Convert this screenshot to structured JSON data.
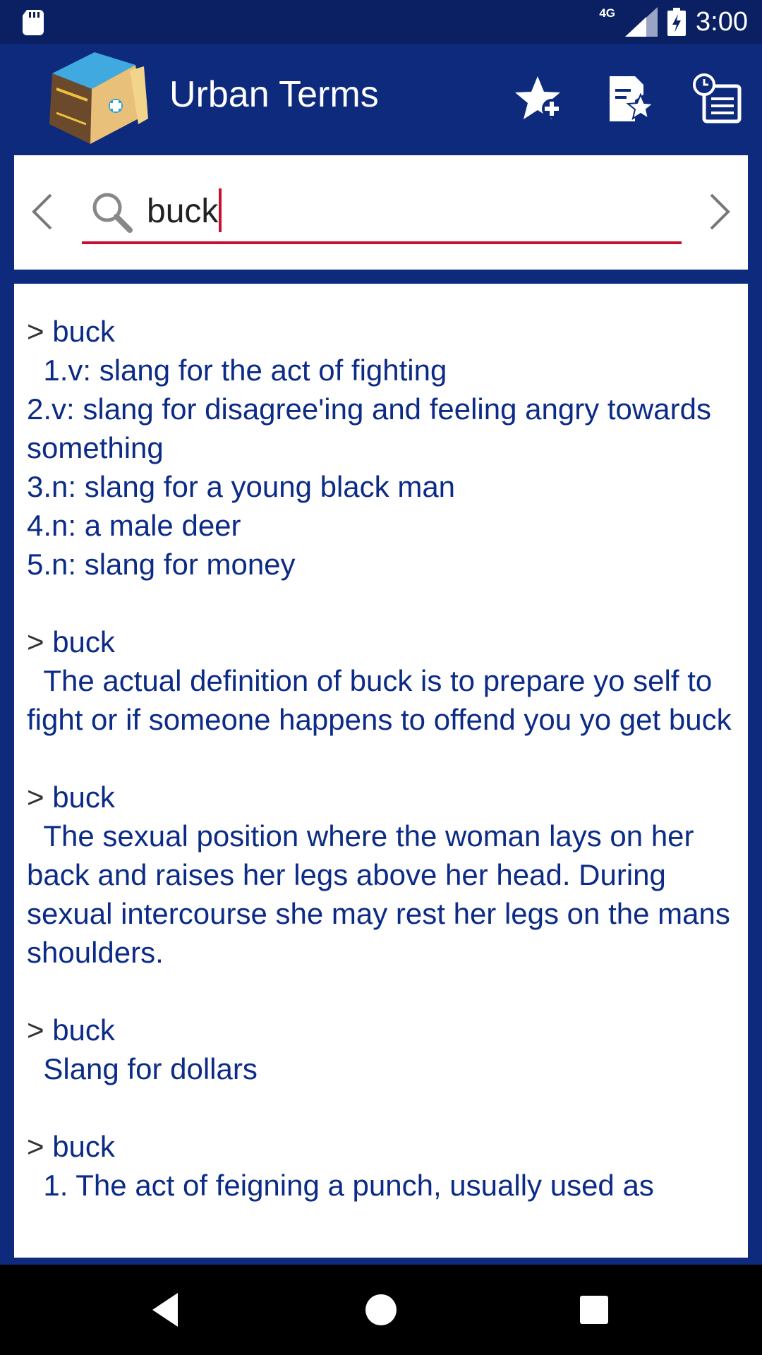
{
  "status_bar": {
    "network": "4G",
    "time": "3:00"
  },
  "app_bar": {
    "title": "Urban Terms",
    "actions": [
      {
        "icon": "star-add-icon"
      },
      {
        "icon": "favorites-list-icon"
      },
      {
        "icon": "history-icon"
      }
    ]
  },
  "search": {
    "query": "buck"
  },
  "definitions": [
    {
      "term": "buck",
      "body": "  1.v: slang for the act of fighting\n2.v: slang for disagree'ing and feeling angry towards something\n3.n: slang for a young black man\n4.n: a male deer\n5.n: slang for money"
    },
    {
      "term": "buck",
      "body": "  The actual definition of buck is to prepare yo self to fight or if someone happens to offend you yo get buck"
    },
    {
      "term": "buck",
      "body": "  The sexual position where the woman lays on her back and raises her legs above her head. During sexual intercourse she may rest her legs on the mans shoulders."
    },
    {
      "term": "buck",
      "body": "  Slang for dollars"
    },
    {
      "term": "buck",
      "body": "  1. The act of feigning a punch, usually used as"
    }
  ],
  "colors": {
    "app_bar": "#0d2a7d",
    "status_bar": "#0a2063",
    "accent": "#c8102e",
    "definition_text": "#0c2b86"
  }
}
